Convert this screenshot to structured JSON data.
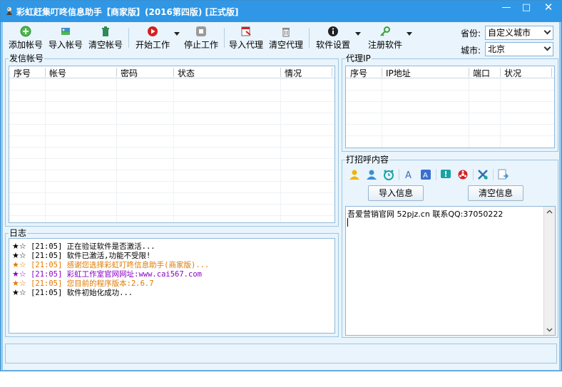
{
  "window": {
    "title": "彩虹赶集叮咚信息助手【商家版】(2016第四版) [正式版]",
    "minimize_glyph": "—",
    "maximize_glyph": "□",
    "close_glyph": "✕"
  },
  "toolbar": {
    "add_account": "添加帐号",
    "import_account": "导入帐号",
    "clear_account": "清空帐号",
    "start_work": "开始工作",
    "stop_work": "停止工作",
    "import_proxy": "导入代理",
    "clear_proxy": "清空代理",
    "settings": "软件设置",
    "register": "注册软件",
    "province_label": "省份:",
    "province_value": "自定义城市",
    "city_label": "城市:",
    "city_value": "北京"
  },
  "accounts": {
    "group_label": "发信帐号",
    "columns": [
      "序号",
      "帐号",
      "密码",
      "状态",
      "情况"
    ]
  },
  "proxy": {
    "group_label": "代理IP",
    "columns": [
      "序号",
      "IP地址",
      "端口",
      "状况"
    ]
  },
  "log": {
    "group_label": "日志",
    "lines": [
      {
        "stars": "★☆",
        "text": "[21:05] 正在验证软件是否激活...",
        "color": "#000000"
      },
      {
        "stars": "★☆",
        "text": "[21:05] 软件已激活,功能不受限!",
        "color": "#000000"
      },
      {
        "stars": "★☆",
        "text": "[21:05] 感谢您选择彩虹叮咚信息助手(商家版)...",
        "color": "#e07a00"
      },
      {
        "stars": "★☆",
        "text": "[21:05] 彩虹工作室官网网址:www.cai567.com",
        "color": "#8a00c8"
      },
      {
        "stars": "★☆",
        "text": "[21:05] 您目前的程序版本:2.6.7",
        "color": "#e07a00"
      },
      {
        "stars": "★☆",
        "text": "[21:05] 软件初始化成功...",
        "color": "#000000"
      }
    ],
    "star_colors": [
      "#000000",
      "#000000",
      "#e07a00",
      "#8a00c8",
      "#e07a00",
      "#000000"
    ]
  },
  "greeting": {
    "group_label": "打招呼内容",
    "import_button": "导入信息",
    "clear_button": "清空信息",
    "content": "吾爱营销官网 52pjz.cn 联系QQ:37050222"
  },
  "colors": {
    "titlebar": "#2f97e6",
    "panel": "#e9f4fc"
  }
}
